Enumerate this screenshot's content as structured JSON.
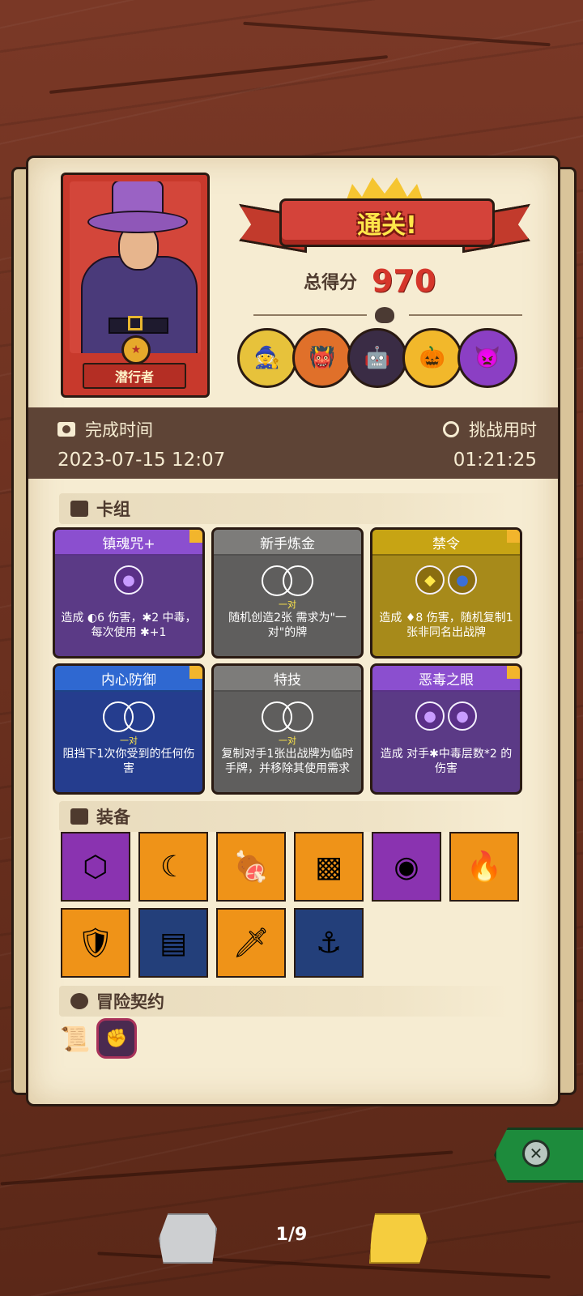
{
  "character": {
    "name": "潜行者"
  },
  "result": {
    "banner": "通关!",
    "score_label": "总得分",
    "score_value": "970"
  },
  "bosses": [
    "yellow-wizard-boss",
    "orange-ogre-boss",
    "dark-robot-boss",
    "sunflower-pumpkin-boss",
    "purple-demon-boss"
  ],
  "info": {
    "finish_label": "完成时间",
    "finish_value": "2023-07-15 12:07",
    "duration_label": "挑战用时",
    "duration_value": "01:21:25"
  },
  "sections": {
    "deck": "卡组",
    "equipment": "装备",
    "contract": "冒险契约"
  },
  "cards": [
    {
      "title": "镇魂咒+",
      "color": "purple",
      "desc": "造成 ◐6 伤害，✱2 中毒，每次使用 ✱+1"
    },
    {
      "title": "新手炼金",
      "color": "grey",
      "pair_caption": "一对",
      "desc": "随机创造2张 需求为\"一对\"的牌"
    },
    {
      "title": "禁令",
      "color": "gold",
      "desc": "造成 ♦8 伤害，随机复制1张非同名出战牌"
    },
    {
      "title": "内心防御",
      "color": "blue",
      "pair_caption": "一对",
      "desc": "阻挡下1次你受到的任何伤害"
    },
    {
      "title": "特技",
      "color": "grey",
      "pair_caption": "一对",
      "desc": "复制对手1张出战牌为临时手牌，并移除其使用需求"
    },
    {
      "title": "恶毒之眼",
      "color": "purple",
      "desc": "造成 对手✱中毒层数*2 的伤害"
    }
  ],
  "equipment": [
    "cube-icon",
    "crescent-rock-icon",
    "ham-leg-icon",
    "green-scroll-icon",
    "wooden-button-icon",
    "fire-gem-icon",
    "skull-shield-icon",
    "totem-icon",
    "crystal-dagger-icon",
    "iron-hook-icon"
  ],
  "pagination": {
    "text": "1/9"
  },
  "colors": {
    "accent_red": "#d5362b",
    "paper": "#f6ecd2",
    "close_green": "#1d8b3c"
  }
}
